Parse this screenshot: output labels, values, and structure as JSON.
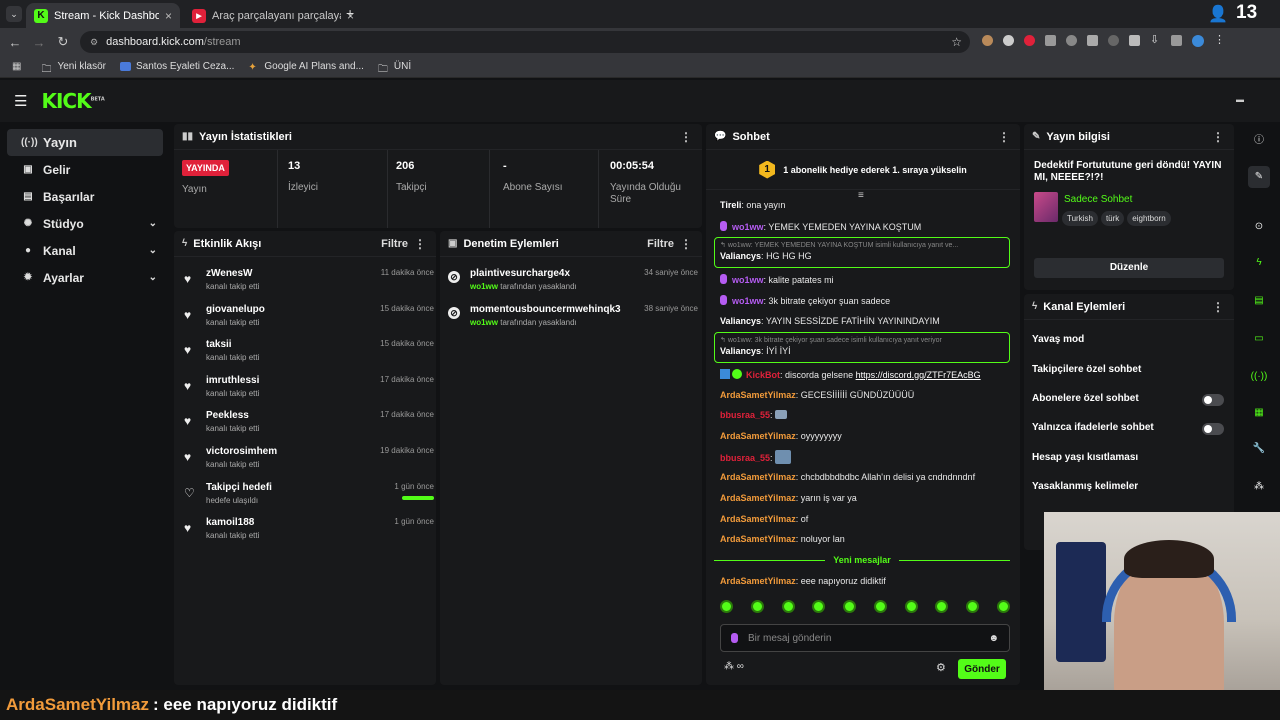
{
  "browser": {
    "tabs": [
      {
        "title": "Stream - Kick Dashboard",
        "active": true
      },
      {
        "title": "Araç parçalayanı parçalayan ba",
        "active": false
      }
    ],
    "url_host": "dashboard.kick.com",
    "url_path": "/stream",
    "bookmarks": [
      "Yeni klasör",
      "Santos Eyaleti Ceza...",
      "Google AI Plans and...",
      "ÜNİ"
    ],
    "viewer_overlay": "13"
  },
  "app": {
    "logo": "KICK",
    "logo_badge": "BETA",
    "accent": "#53fc18"
  },
  "nav": [
    {
      "label": "Yayın",
      "icon": "broadcast-icon",
      "active": true
    },
    {
      "label": "Gelir",
      "icon": "money-icon"
    },
    {
      "label": "Başarılar",
      "icon": "badge-icon"
    },
    {
      "label": "Stüdyo",
      "icon": "gear-icon",
      "expandable": true
    },
    {
      "label": "Kanal",
      "icon": "user-icon",
      "expandable": true
    },
    {
      "label": "Ayarlar",
      "icon": "settings-icon",
      "expandable": true
    }
  ],
  "stats": {
    "title": "Yayın İstatistikleri",
    "status_badge": "YAYINDA",
    "status_label": "Yayın",
    "items": [
      {
        "value": "13",
        "label": "İzleyici"
      },
      {
        "value": "206",
        "label": "Takipçi"
      },
      {
        "value": "-",
        "label": "Abone Sayısı"
      },
      {
        "value": "00:05:54",
        "label": "Yayında Olduğu Süre"
      }
    ]
  },
  "activity": {
    "title": "Etkinlik Akışı",
    "filter": "Filtre",
    "items": [
      {
        "name": "zWenesW",
        "sub": "kanalı takip etti",
        "time": "11 dakika önce"
      },
      {
        "name": "giovanelupo",
        "sub": "kanalı takip etti",
        "time": "15 dakika önce"
      },
      {
        "name": "taksii",
        "sub": "kanalı takip etti",
        "time": "15 dakika önce"
      },
      {
        "name": "imruthlessi",
        "sub": "kanalı takip etti",
        "time": "17 dakika önce"
      },
      {
        "name": "Peekless",
        "sub": "kanalı takip etti",
        "time": "17 dakika önce"
      },
      {
        "name": "victorosimhem",
        "sub": "kanalı takip etti",
        "time": "19 dakika önce"
      },
      {
        "name": "Takipçi hedefi",
        "sub": "hedefe ulaşıldı",
        "time": "1 gün önce",
        "goal_progress": 1.0
      },
      {
        "name": "kamoil188",
        "sub": "kanalı takip etti",
        "time": "1 gün önce"
      }
    ]
  },
  "moderation": {
    "title": "Denetim Eylemleri",
    "filter": "Filtre",
    "items": [
      {
        "name": "plaintivesurcharge4x",
        "by": "wo1ww",
        "action": "tarafından yasaklandı",
        "time": "34 saniye önce"
      },
      {
        "name": "momentousbouncermwehinqk3",
        "by": "wo1ww",
        "action": "tarafından yasaklandı",
        "time": "38 saniye önce"
      }
    ]
  },
  "chat": {
    "title": "Sohbet",
    "promo_rank": "1",
    "promo": "1 abonelik hediye ederek 1. sıraya yükselin",
    "messages": [
      {
        "user": "Tireli",
        "text": "ona yayın",
        "color": "uw"
      },
      {
        "user": "wo1ww",
        "text": "YEMEK YEMEDEN YAYINA KOŞTUM",
        "color": "mic"
      },
      {
        "reply_to": "wo1ww: YEMEK YEMEDEN YAYINA KOŞTUM isimli kullanıcıya yanıt ve...",
        "user": "Valiancys",
        "text": "HG HG HG"
      },
      {
        "user": "wo1ww",
        "text": "kalite patates mi",
        "color": "mic"
      },
      {
        "user": "wo1ww",
        "text": "3k bitrate çekiyor şuan sadece",
        "color": "mic"
      },
      {
        "user": "Valiancys",
        "text": "YAYIN SESSİZDE FATİHİN YAYININDAYIM",
        "color": "uw"
      },
      {
        "reply_to": "wo1ww: 3k bitrate çekiyor şuan sadece isimli kullanıcıya yanıt veriyor",
        "user": "Valiancys",
        "text": "İYİ İYİ"
      },
      {
        "user": "KickBot",
        "text": "discorda gelsene",
        "link": "https://discord.gg/ZTFr7EAcBG",
        "color": "ur"
      },
      {
        "user": "ArdaSametYilmaz",
        "text": "GECESİİİİİİ GÜNDÜZÜÜÜÜ",
        "color": "uo"
      },
      {
        "user": "bbusraa_55",
        "text": "",
        "color": "ur"
      },
      {
        "user": "ArdaSametYilmaz",
        "text": "oyyyyyyyy",
        "color": "uo"
      },
      {
        "user": "bbusraa_55",
        "text": "",
        "color": "ur"
      },
      {
        "user": "ArdaSametYilmaz",
        "text": "chcbdbbdbdbc Allah'ın delisi ya cndndnndnf",
        "color": "uo"
      },
      {
        "user": "ArdaSametYilmaz",
        "text": "yarın iş var ya",
        "color": "uo"
      },
      {
        "user": "ArdaSametYilmaz",
        "text": "of",
        "color": "uo"
      },
      {
        "user": "ArdaSametYilmaz",
        "text": "noluyor lan",
        "color": "uo"
      },
      {
        "user": "ArdaSametYilmaz",
        "text": "eee napıyoruz didiktif",
        "color": "uo"
      }
    ],
    "new_messages": "Yeni mesajlar",
    "input_placeholder": "Bir mesaj gönderin",
    "send": "Gönder"
  },
  "stream_info": {
    "title": "Yayın bilgisi",
    "stream_title": "Dedektif Fortututune geri döndü! YAYIN MI, NEEEE?!?!",
    "category": "Sadece Sohbet",
    "tags": [
      "Turkish",
      "türk",
      "eightborn"
    ],
    "edit": "Düzenle"
  },
  "channel_actions": {
    "title": "Kanal Eylemleri",
    "items": [
      {
        "label": "Yavaş mod",
        "type": "chevron"
      },
      {
        "label": "Takipçilere özel sohbet",
        "type": "chevron"
      },
      {
        "label": "Abonelere özel sohbet",
        "type": "toggle"
      },
      {
        "label": "Yalnızca ifadelerle sohbet",
        "type": "toggle"
      },
      {
        "label": "Hesap yaşı kısıtlaması",
        "type": "chevron"
      },
      {
        "label": "Yasaklanmış kelimeler",
        "type": "chevron"
      }
    ]
  },
  "overlay": {
    "user": "ArdaSametYilmaz",
    "text": ": eee napıyoruz didiktif"
  }
}
